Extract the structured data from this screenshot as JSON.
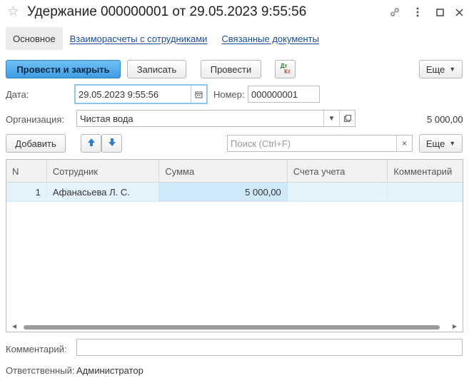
{
  "window": {
    "title": "Удержание 000000001 от 29.05.2023 9:55:56",
    "star_icon": "star-icon",
    "link_icon": "link-icon",
    "menu_icon": "more-vertical-icon",
    "maximize_icon": "maximize-icon",
    "close_icon": "close-icon"
  },
  "tabs": [
    {
      "label": "Основное"
    },
    {
      "label": "Взаиморасчеты с сотрудниками"
    },
    {
      "label": "Связанные документы"
    }
  ],
  "toolbar": {
    "post_close": "Провести и закрыть",
    "save": "Записать",
    "post": "Провести",
    "dtkt_top": "Дт",
    "dtkt_bottom": "Кт",
    "more": "Еще"
  },
  "form": {
    "date_label": "Дата:",
    "date_value": "29.05.2023  9:55:56",
    "number_label": "Номер:",
    "number_value": "000000001",
    "org_label": "Организация:",
    "org_value": "Чистая вода",
    "total": "5 000,00"
  },
  "table_toolbar": {
    "add": "Добавить",
    "search_placeholder": "Поиск (Ctrl+F)",
    "more": "Еще"
  },
  "table": {
    "columns": [
      "N",
      "Сотрудник",
      "Сумма",
      "Счета учета",
      "Комментарий"
    ],
    "rows": [
      {
        "n": "1",
        "employee": "Афанасьева Л. С.",
        "amount": "5 000,00",
        "accounts": "",
        "comment": ""
      }
    ]
  },
  "footer": {
    "comment_label": "Комментарий:",
    "comment_value": "",
    "responsible_label": "Ответственный:",
    "responsible_value": "Администратор"
  },
  "colors": {
    "primary_button": "#4aa8e8",
    "link": "#1a4c9c",
    "selected_row": "#e3f2fb"
  }
}
